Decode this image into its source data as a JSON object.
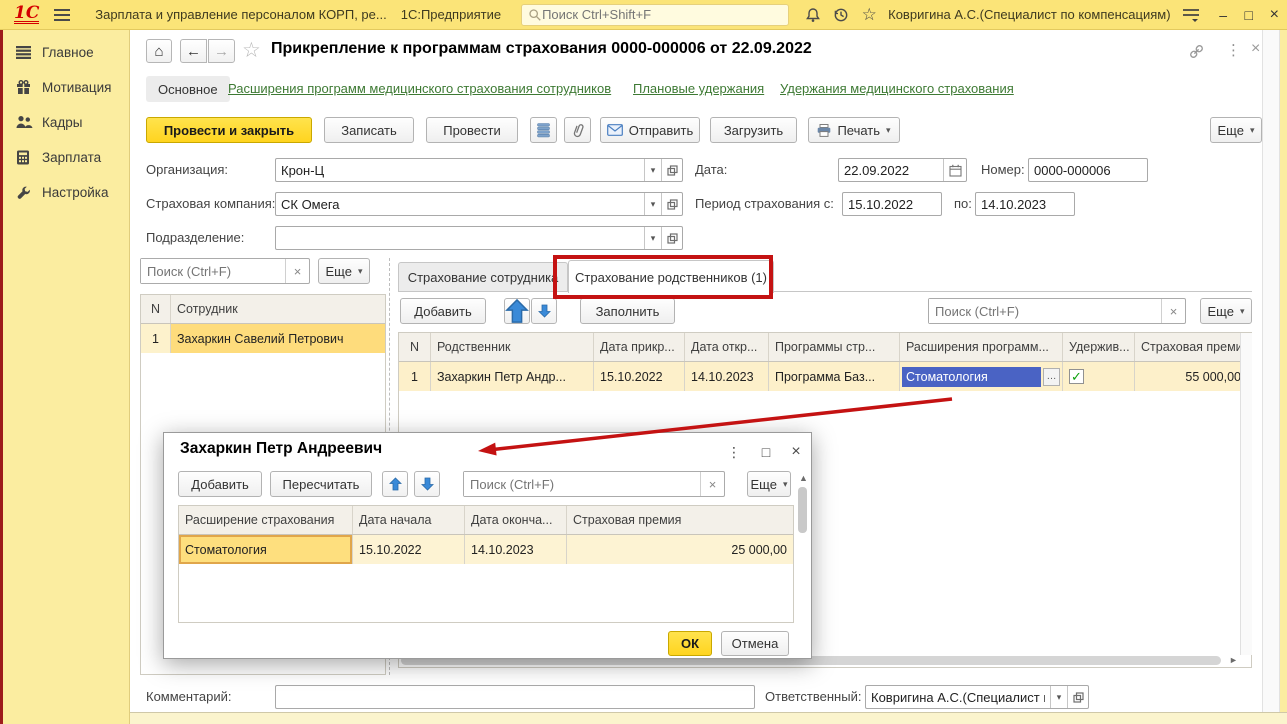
{
  "topbar": {
    "logo": "1С",
    "app_title": "Зарплата и управление персоналом КОРП, ре...",
    "platform": "1С:Предприятие",
    "search_placeholder": "Поиск Ctrl+Shift+F",
    "user": "Ковригина А.С.(Специалист по компенсациям)"
  },
  "sidebar": {
    "items": [
      {
        "label": "Главное"
      },
      {
        "label": "Мотивация"
      },
      {
        "label": "Кадры"
      },
      {
        "label": "Зарплата"
      },
      {
        "label": "Настройка"
      }
    ]
  },
  "doc": {
    "title": "Прикрепление к программам страхования 0000-000006 от 22.09.2022",
    "nav": {
      "main": "Основное",
      "extensions": "Расширения программ медицинского страхования сотрудников",
      "planned": "Плановые удержания",
      "withholdings": "Удержания медицинского страхования"
    },
    "toolbar": {
      "post_and_close": "Провести и закрыть",
      "write": "Записать",
      "post": "Провести",
      "send": "Отправить",
      "load": "Загрузить",
      "print": "Печать",
      "more": "Еще"
    },
    "fields": {
      "org_label": "Организация:",
      "org_value": "Крон-Ц",
      "insurer_label": "Страховая компания:",
      "insurer_value": "СК Омега",
      "division_label": "Подразделение:",
      "division_value": "",
      "date_label": "Дата:",
      "date_value": "22.09.2022",
      "number_label": "Номер:",
      "number_value": "0000-000006",
      "period_label": "Период страхования с:",
      "period_from": "15.10.2022",
      "period_to_label": "по:",
      "period_to": "14.10.2023"
    },
    "comment_label": "Комментарий:",
    "comment_value": "",
    "responsible_label": "Ответственный:",
    "responsible_value": "Ковригина А.С.(Специалист по компенсациям)"
  },
  "employees": {
    "search_placeholder": "Поиск (Ctrl+F)",
    "more": "Еще",
    "columns": [
      "N",
      "Сотрудник"
    ],
    "row": {
      "n": "1",
      "name": "Захаркин Савелий Петрович"
    }
  },
  "relatives": {
    "tab_employee": "Страхование сотрудника",
    "tab_relatives": "Страхование родственников (1)",
    "add": "Добавить",
    "fill": "Заполнить",
    "more": "Еще",
    "search_placeholder": "Поиск (Ctrl+F)",
    "columns": [
      "N",
      "Родственник",
      "Дата прикр...",
      "Дата откр...",
      "Программы стр...",
      "Расширения программ...",
      "Удержив...",
      "Страховая премия"
    ],
    "row": {
      "n": "1",
      "name": "Захаркин Петр Андр...",
      "date_from": "15.10.2022",
      "date_to": "14.10.2023",
      "program": "Программа Баз...",
      "extension": "Стоматология",
      "withheld": true,
      "premium": "55 000,00"
    }
  },
  "modal": {
    "title": "Захаркин Петр Андреевич",
    "add": "Добавить",
    "recalculate": "Пересчитать",
    "more": "Еще",
    "search_placeholder": "Поиск (Ctrl+F)",
    "columns": [
      "Расширение страхования",
      "Дата начала",
      "Дата оконча...",
      "Страховая премия"
    ],
    "row": {
      "extension": "Стоматология",
      "date_from": "15.10.2022",
      "date_to": "14.10.2023",
      "premium": "25 000,00"
    },
    "ok": "ОК",
    "cancel": "Отмена"
  },
  "icons": {
    "dropdown": "▾",
    "home": "⌂",
    "back": "←",
    "forward": "→",
    "star": "☆",
    "more_dots": "⋮",
    "close": "×",
    "minimize": "–",
    "maximize": "□",
    "clear": "×",
    "check": "✓",
    "ellipsis": "…",
    "scroll_right": "►",
    "scroll_up": "▲"
  },
  "colors": {
    "titlebar_yellow": "#fbe478",
    "sidebar_yellow": "#fbeda0",
    "accent_button_yellow": "#ffd41f",
    "selection_blue": "#4a63c4",
    "row_highlight": "#fdf0ca",
    "selected_row_orange": "#fedc7c",
    "annotation_red": "#c41212",
    "link_green": "#3e7a34"
  }
}
